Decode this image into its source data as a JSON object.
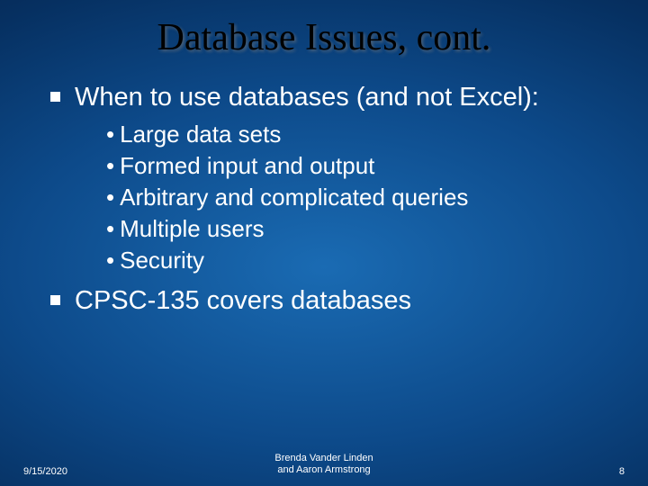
{
  "title": "Database Issues, cont.",
  "bullets": {
    "b1": "When to use databases (and not Excel):",
    "sub": {
      "s1": "Large data sets",
      "s2": "Formed input and output",
      "s3": "Arbitrary and complicated queries",
      "s4": "Multiple users",
      "s5": "Security"
    },
    "b2": "CPSC-135 covers databases"
  },
  "footer": {
    "date": "9/15/2020",
    "author_line1": "Brenda Vander Linden",
    "author_line2": "and Aaron Armstrong",
    "page": "8"
  }
}
